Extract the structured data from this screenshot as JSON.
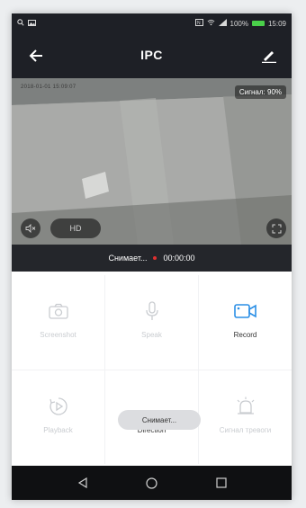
{
  "status_bar": {
    "left_icons": [
      "search-icon",
      "image-icon"
    ],
    "battery_text": "100%",
    "time": "15:09"
  },
  "app_bar": {
    "title": "IPC",
    "back_icon": "arrow-left-icon",
    "edit_icon": "pencil-icon"
  },
  "video": {
    "timestamp": "2018-01-01  15:09:07",
    "signal": "Сигнал: 90%",
    "quality_label": "HD"
  },
  "recording_bar": {
    "status": "Снимает...",
    "timer": "00:00:00",
    "dot_color": "#e03030"
  },
  "controls": [
    {
      "label": "Screenshot",
      "icon": "camera-icon",
      "active": false
    },
    {
      "label": "Speak",
      "icon": "microphone-icon",
      "active": false
    },
    {
      "label": "Record",
      "icon": "video-camera-icon",
      "active": true
    },
    {
      "label": "Playback",
      "icon": "playback-icon",
      "active": false
    },
    {
      "label": "Direction",
      "icon": "direction-icon",
      "active": true
    },
    {
      "label": "Сигнал тревоги",
      "icon": "alarm-icon",
      "active": false
    }
  ],
  "toast": "Снимает...",
  "colors": {
    "accent": "#2b8fe6",
    "bar_bg": "#1e2026"
  }
}
